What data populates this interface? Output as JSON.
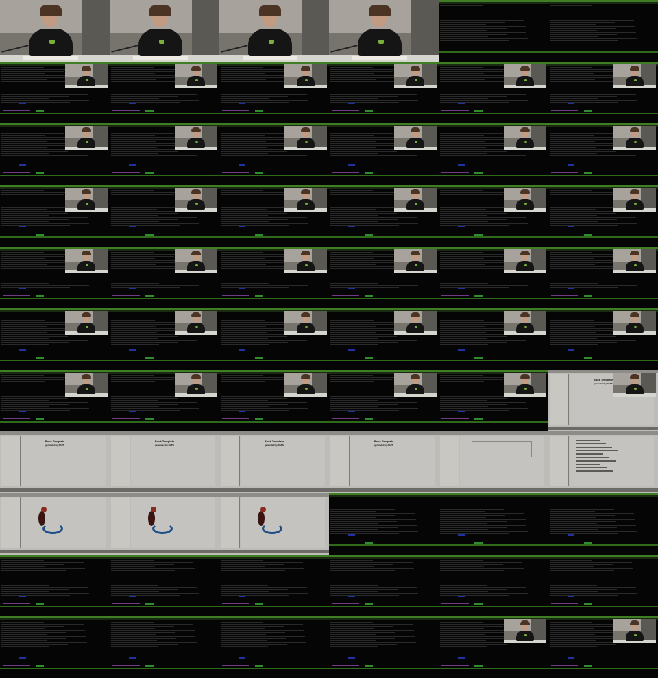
{
  "contact_sheet": {
    "columns": 6,
    "rows": 11,
    "frames": [
      "full",
      "full",
      "full",
      "full",
      "term-top",
      "term-top",
      "term-video",
      "term-video",
      "term-video",
      "term-video",
      "term-video",
      "term-video",
      "term-video",
      "term-video",
      "term-video",
      "term-video",
      "term-video",
      "term-video",
      "term-video",
      "term-video",
      "term-video",
      "term-video",
      "term-video",
      "term-video",
      "term-video",
      "term-video",
      "term-video",
      "term-video",
      "term-video",
      "term-video",
      "term-video",
      "term-video",
      "term-video",
      "term-video",
      "term-video",
      "term-video",
      "term-video",
      "term-video",
      "term-video",
      "term-video",
      "term-video",
      "pdf-video",
      "pdf-title",
      "pdf-title",
      "pdf-title",
      "pdf-title",
      "pdf-toc",
      "pdf-chapter",
      "pdf-image",
      "pdf-image",
      "pdf-image",
      "term",
      "term",
      "term",
      "term",
      "term",
      "term",
      "term",
      "term",
      "term",
      "term",
      "term",
      "term",
      "term",
      "term-video",
      "term-video"
    ]
  },
  "pdf_viewer": {
    "title": "Book Template",
    "subtitle": "generated by DAPS",
    "toc_title": "Table of Contents",
    "chapter_title": "Chapter 1. Examples: the most commonly used DocBook XML constructs",
    "chapter_items": [
      "Lists",
      "Itemized Lists",
      "Ordered Lists",
      "Procedures"
    ]
  },
  "colors": {
    "terminal_bg": "#000000",
    "status_green": "#3f7e22",
    "prompt_purple": "#6e3b84",
    "pdf_gray": "#bdbcb8"
  }
}
